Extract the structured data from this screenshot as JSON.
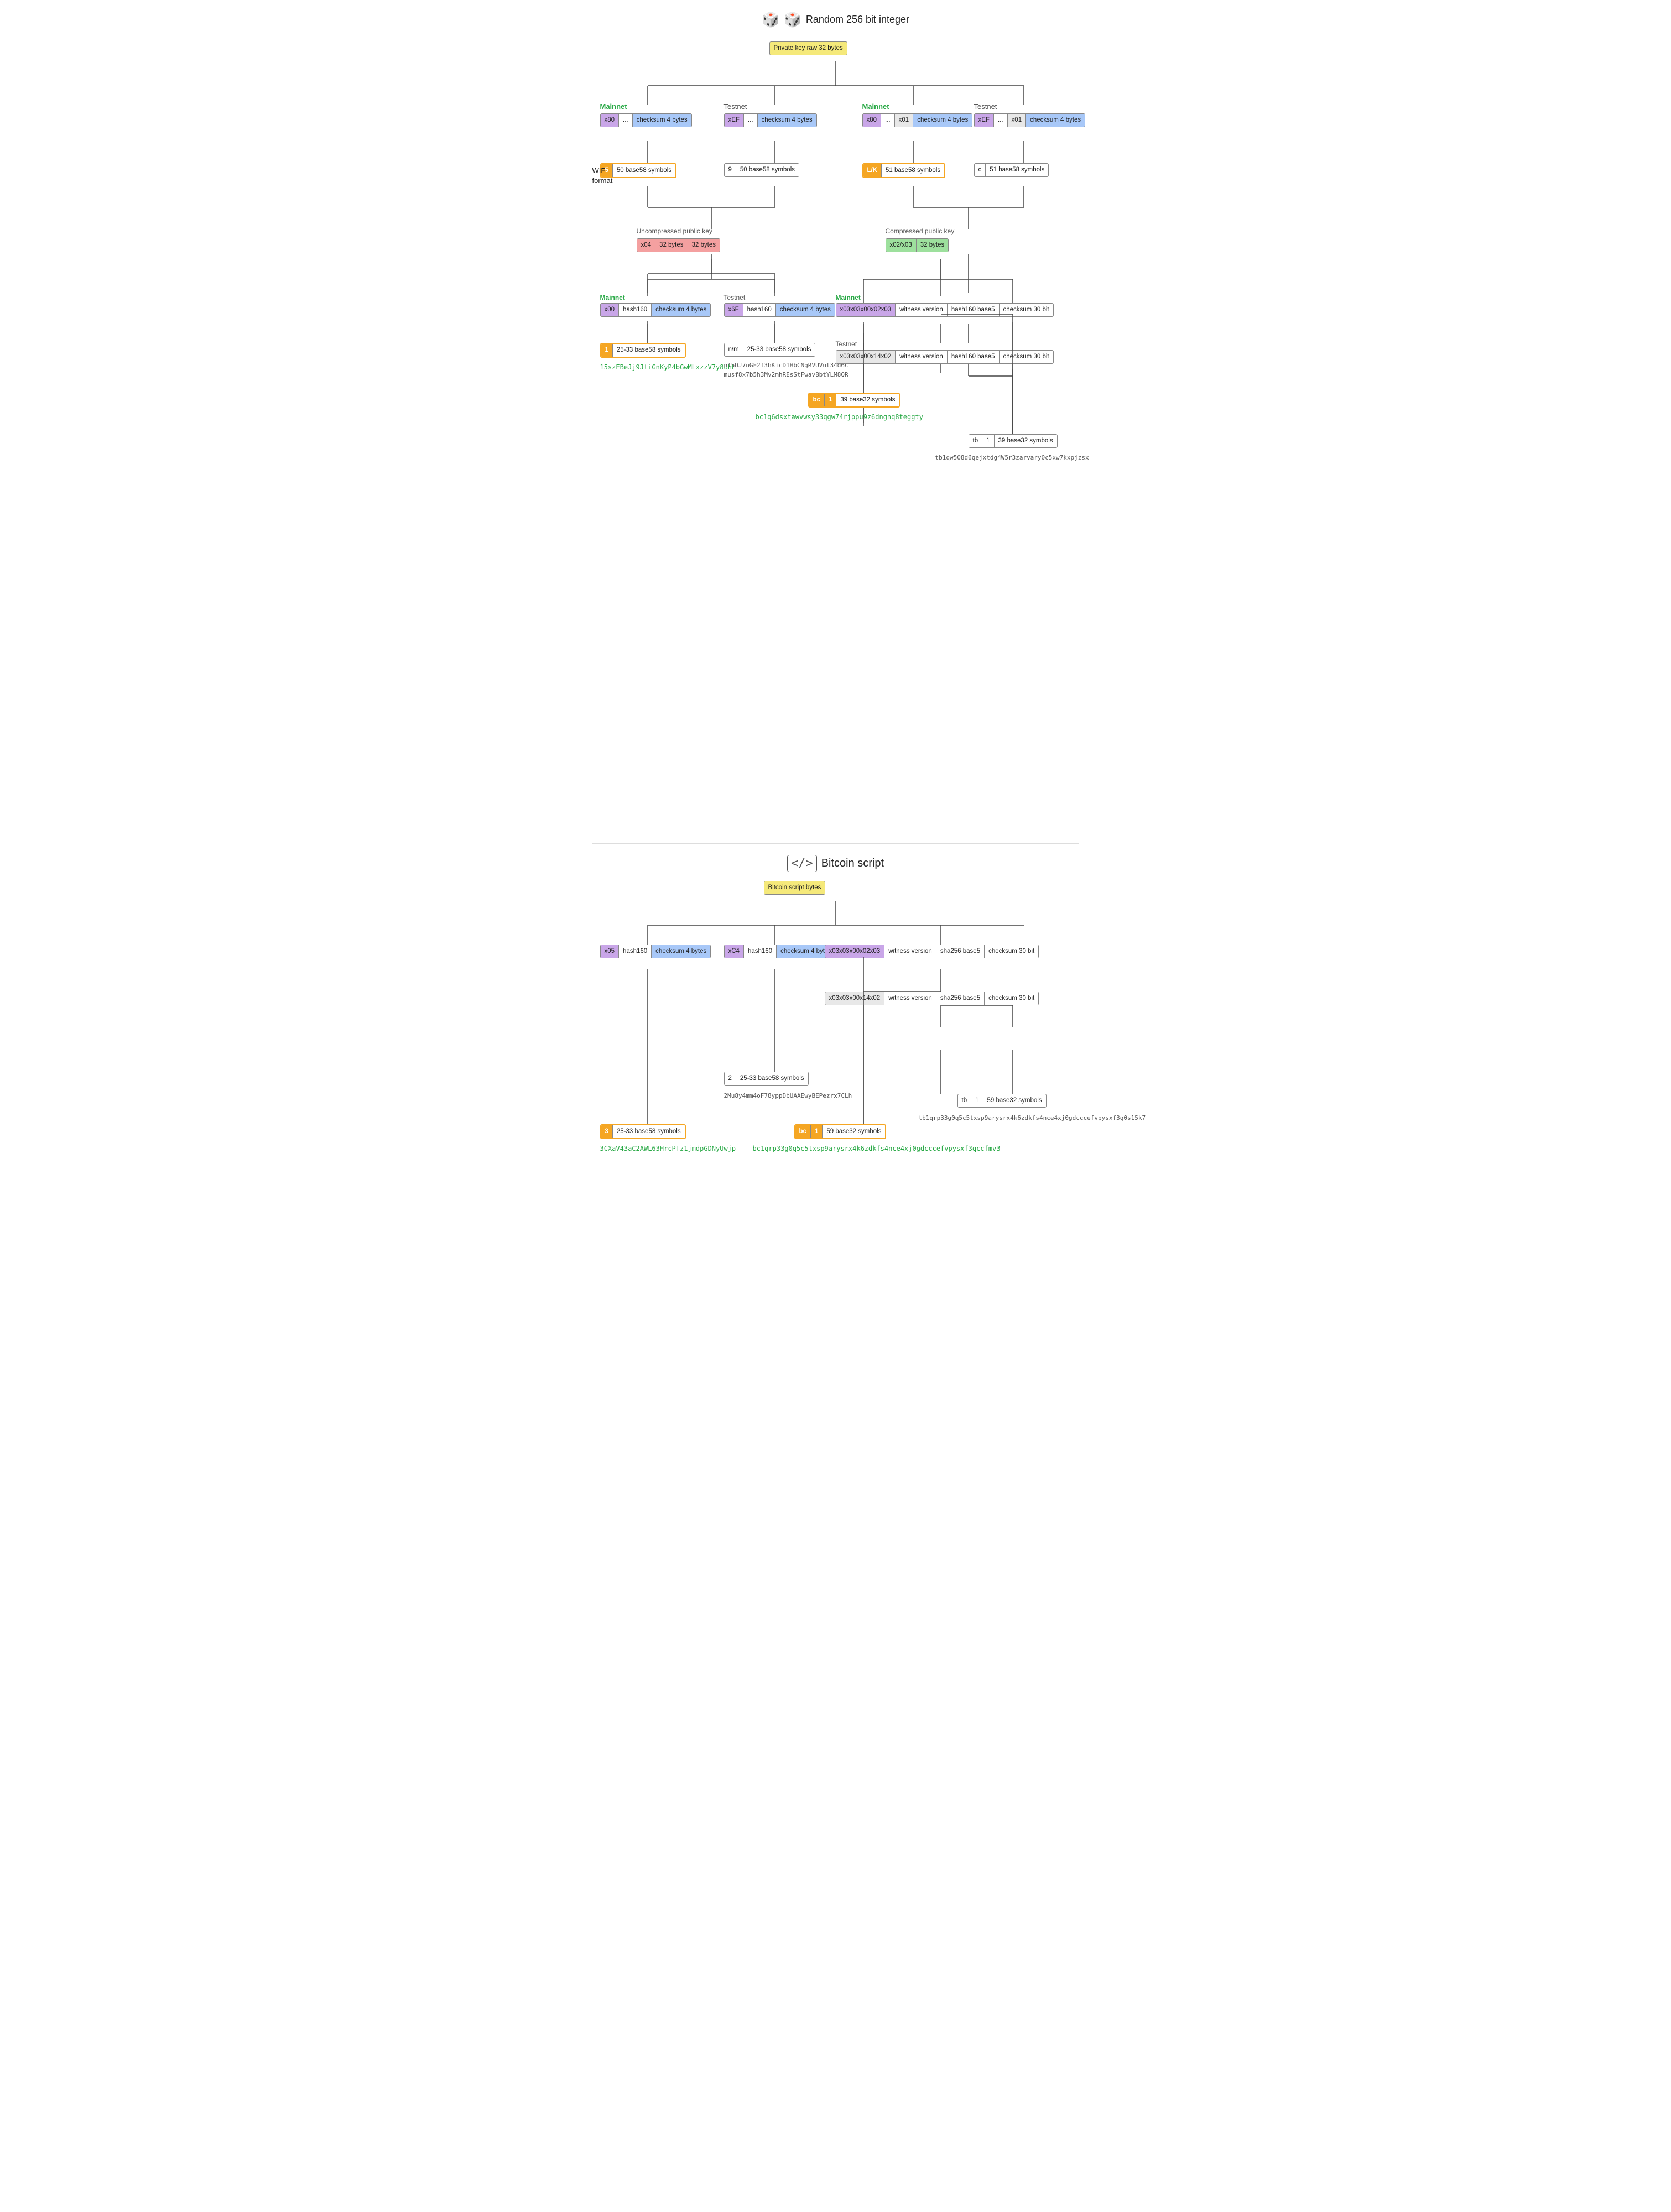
{
  "header": {
    "title": "Random 256 bit integer",
    "dice": "🎲 🎲"
  },
  "section1": {
    "title": "Bitcoin script",
    "script_icon": "</>",
    "private_key_label": "Private key raw 32 bytes",
    "bitcoin_script_label": "Bitcoin script bytes"
  },
  "wif": {
    "label": "WIF\nformat",
    "mainnet_label": "Mainnet",
    "testnet_label": "Testnet",
    "mainnet2_label": "Mainnet",
    "testnet2_label": "Testnet"
  },
  "nodes": {
    "pk_box": {
      "cells": [
        {
          "text": "Private key raw 32 bytes",
          "cls": "cy"
        }
      ]
    },
    "mn1_bytes": [
      {
        "text": "x80",
        "cls": "cp"
      },
      {
        "text": "...",
        "cls": "cw"
      },
      {
        "text": "checksum 4 bytes",
        "cls": "cb"
      }
    ],
    "tn1_bytes": [
      {
        "text": "xEF",
        "cls": "cp"
      },
      {
        "text": "...",
        "cls": "cw"
      },
      {
        "text": "checksum 4 bytes",
        "cls": "cb"
      }
    ],
    "mn2_bytes": [
      {
        "text": "x80",
        "cls": "cp"
      },
      {
        "text": "...",
        "cls": "cw"
      },
      {
        "text": "x01",
        "cls": "cgr"
      },
      {
        "text": "checksum 4 bytes",
        "cls": "cb"
      }
    ],
    "tn2_bytes": [
      {
        "text": "xEF",
        "cls": "cp"
      },
      {
        "text": "...",
        "cls": "cw"
      },
      {
        "text": "x01",
        "cls": "cgr"
      },
      {
        "text": "checksum 4 bytes",
        "cls": "cb"
      }
    ],
    "wif_mn1": [
      {
        "text": "5",
        "cls": "co"
      },
      {
        "text": "50 base58 symbols",
        "cls": "cw"
      }
    ],
    "wif_tn1": [
      {
        "text": "9",
        "cls": "cw"
      },
      {
        "text": "50 base58 symbols",
        "cls": "cw"
      }
    ],
    "wif_mn2": [
      {
        "text": "L/K",
        "cls": "co"
      },
      {
        "text": "51 base58 symbols",
        "cls": "cw"
      }
    ],
    "wif_tn2": [
      {
        "text": "c",
        "cls": "cw"
      },
      {
        "text": "51 base58 symbols",
        "cls": "cw"
      }
    ],
    "uncomp_pk": [
      {
        "text": "x04",
        "cls": "cpk"
      },
      {
        "text": "32 bytes",
        "cls": "cpk"
      },
      {
        "text": "32 bytes",
        "cls": "cpk"
      }
    ],
    "comp_pk": [
      {
        "text": "x02/x03",
        "cls": "cg"
      },
      {
        "text": "32 bytes",
        "cls": "cg"
      }
    ],
    "mn_addr_bytes": [
      {
        "text": "x00",
        "cls": "cp"
      },
      {
        "text": "hash160",
        "cls": "cw"
      },
      {
        "text": "checksum 4 bytes",
        "cls": "cb"
      }
    ],
    "tn_addr_bytes": [
      {
        "text": "x6F",
        "cls": "cp"
      },
      {
        "text": "hash160",
        "cls": "cw"
      },
      {
        "text": "checksum 4 bytes",
        "cls": "cb"
      }
    ],
    "mn_addr_wif": [
      {
        "text": "1",
        "cls": "co"
      },
      {
        "text": "25-33 base58 symbols",
        "cls": "cw"
      }
    ],
    "tn_addr_wif": [
      {
        "text": "n/m",
        "cls": "cw"
      },
      {
        "text": "25-33 base58 symbols",
        "cls": "cw"
      }
    ],
    "mn_bech32_bytes": [
      {
        "text": "x03x03x00x02x03",
        "cls": "cp"
      },
      {
        "text": "witness version",
        "cls": "cw"
      },
      {
        "text": "hash160 base5",
        "cls": "cw"
      },
      {
        "text": "checksum 30 bit",
        "cls": "cw"
      }
    ],
    "tn_bech32_bytes": [
      {
        "text": "x03x03x00x14x02",
        "cls": "cgr"
      },
      {
        "text": "witness version",
        "cls": "cw"
      },
      {
        "text": "hash160 base5",
        "cls": "cw"
      },
      {
        "text": "checksum 30 bit",
        "cls": "cw"
      }
    ],
    "bc_bech32": [
      {
        "text": "bc",
        "cls": "co"
      },
      {
        "text": "1",
        "cls": "co"
      },
      {
        "text": "39 base32 symbols",
        "cls": "cw"
      }
    ],
    "tb_bech32": [
      {
        "text": "tb",
        "cls": "cw"
      },
      {
        "text": "1",
        "cls": "cw"
      },
      {
        "text": "39 base32 symbols",
        "cls": "cw"
      }
    ],
    "bs_bytes": [
      {
        "cells": [
          {
            "text": "Bitcoin script bytes",
            "cls": "cy"
          }
        ]
      }
    ],
    "bs_x05": [
      {
        "text": "x05",
        "cls": "cp"
      },
      {
        "text": "hash160",
        "cls": "cw"
      },
      {
        "text": "checksum 4 bytes",
        "cls": "cb"
      }
    ],
    "bs_xC4": [
      {
        "text": "xC4",
        "cls": "cp"
      },
      {
        "text": "hash160",
        "cls": "cw"
      },
      {
        "text": "checksum 4 bytes",
        "cls": "cb"
      }
    ],
    "bs_mn_bech32": [
      {
        "text": "x03x03x00x02x03",
        "cls": "cp"
      },
      {
        "text": "witness version",
        "cls": "cw"
      },
      {
        "text": "sha256 base5",
        "cls": "cw"
      },
      {
        "text": "checksum 30 bit",
        "cls": "cw"
      }
    ],
    "bs_tn_bech32": [
      {
        "text": "x03x03x00x14x02",
        "cls": "cgr"
      },
      {
        "text": "witness version",
        "cls": "cw"
      },
      {
        "text": "sha256 base5",
        "cls": "cw"
      },
      {
        "text": "checksum 30 bit",
        "cls": "cw"
      }
    ],
    "bs_3addr": [
      {
        "text": "3",
        "cls": "co"
      },
      {
        "text": "25-33 base58 symbols",
        "cls": "cw"
      }
    ],
    "bs_2addr": [
      {
        "text": "2",
        "cls": "cw"
      },
      {
        "text": "25-33 base58 symbols",
        "cls": "cw"
      }
    ],
    "bs_bc_bech32": [
      {
        "text": "bc",
        "cls": "co"
      },
      {
        "text": "1",
        "cls": "co"
      },
      {
        "text": "59 base32 symbols",
        "cls": "cw"
      }
    ],
    "bs_tb_bech32": [
      {
        "text": "tb",
        "cls": "cw"
      },
      {
        "text": "1",
        "cls": "cw"
      },
      {
        "text": "59 base32 symbols",
        "cls": "cw"
      }
    ]
  },
  "addresses": {
    "mn1": "15szEBeJj9JtiGnKyP4bGwMLxzzV7y8UhL",
    "tn1_1": "n15DJ7nGF2f3hKicD1HbCNgRVUVut34d6C",
    "tn1_2": "musf8x7b5h3Mv2mhREsStFwavBbtYLM8QR",
    "bc1": "bc1q6dsxtawvwsy33qgw74rjppu9z6dngnq8teggty",
    "tb1": "tb1qw508d6qejxtdg4W5r3zarvary0c5xw7kxpjzsx",
    "bs3": "3CXaV43aC2AWL63HrcPTz1jmdpGDNyUwjp",
    "bs2": "2Mu8y4mm4oF78yppDbUAAEwyBEPezrx7CLh",
    "bs_bc1": "bc1qrp33g0q5c5txsp9arysrx4k6zdkfs4nce4xj0gdcccefvpysxf3qccfmv3",
    "bs_tb1": "tb1qrp33g0q5c5txsp9arysrx4k6zdkfs4nce4xj0gdcccefvpysxf3q0s15k7"
  }
}
